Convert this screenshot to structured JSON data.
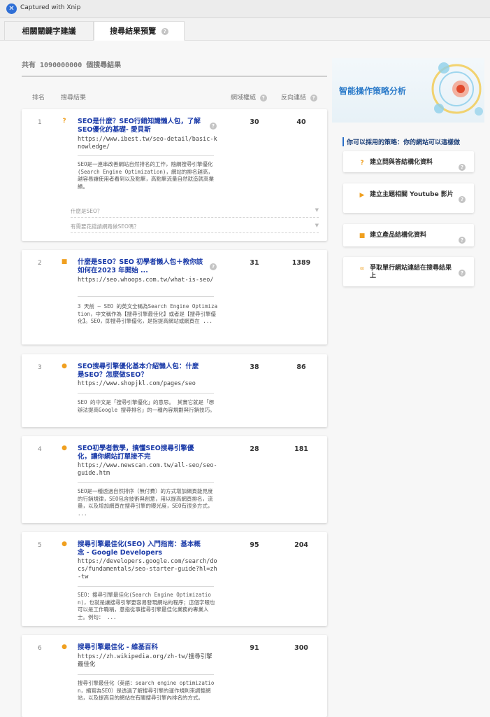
{
  "window": {
    "capture_label": "Captured with Xnip"
  },
  "tabs": [
    {
      "label": "相關關鍵字建議"
    },
    {
      "label": "搜尋結果預覽"
    }
  ],
  "summary": {
    "total_text": "共有 1090000000 個搜尋結果"
  },
  "columns": {
    "rank": "排名",
    "result": "搜尋結果",
    "authority": "網域權威",
    "backlinks": "反向連結"
  },
  "results": [
    {
      "rank": "1",
      "icon": "question-icon",
      "title": "SEO是什麼？SEO行銷知識懶人包，了解SEO優化的基礎- 愛貝斯",
      "url": "https://www.ibest.tw/seo-detail/basic-knowledge/",
      "desc": "SEO是一連串改善網站自然排名的工作，隨網搜尋引擎優化(Search Engine Optimization)，網站的排名越高，越容易讓使用者看到以及點擊，高點擊流量自然就造就高業績。",
      "authority": "30",
      "backlinks": "40",
      "faqs": [
        "什麼是SEO？",
        "有需要花錢請網路做SEO嗎？"
      ]
    },
    {
      "rank": "2",
      "icon": "box-icon",
      "title": "什麼是SEO？SEO 初學者懶人包＋教你該如何在2023 年開始 ...",
      "url": "https://seo.whoops.com.tw/what-is-seo/",
      "desc": "3 天前 — SEO 的英文全稱為Search Engine Optimization，中文稱作為【搜尋引擎最佳化】或者是【搜尋引擎優化】。SEO，即搜尋引擎優化，是指提高網站或網頁在 ...",
      "authority": "31",
      "backlinks": "1389"
    },
    {
      "rank": "3",
      "icon": "chat-icon",
      "title": "SEO搜尋引擎優化基本介紹懶人包：什麼是SEO？怎麼做SEO？",
      "url": "https://www.shopjkl.com/pages/seo",
      "desc": "SEO 的中文是「搜尋引擎優化」的意思。 其實它就是「想辦法提高Google 搜尋排名」的一種內容規劃與行銷技巧。",
      "authority": "38",
      "backlinks": "86"
    },
    {
      "rank": "4",
      "icon": "chat-icon",
      "title": "SEO初學者教學，搞懂SEO搜尋引擎優化，讓你網站訂單接不完",
      "url": "https://www.newscan.com.tw/all-seo/seo-guide.htm",
      "desc": "SEO是一種透過自然排序（無付費）的方式增加網頁能見度的行銷規律，SEO包含技術與創意，用以提高網頁排名，流量，以及增加網頁在搜尋引擎的曝光度，SEO有很多方式， ...",
      "authority": "28",
      "backlinks": "181"
    },
    {
      "rank": "5",
      "icon": "chat-icon",
      "title": "搜尋引擎最佳化(SEO) 入門指南：基本概念 - Google Developers",
      "url": "https://developers.google.com/search/docs/fundamentals/seo-starter-guide?hl=zh-tw",
      "desc": "SEO：搜尋引擎最佳化(Search Engine Optimization)，也就是讓搜尋引擎更容易發現網站的程序；這個字眼也可以是工作職稱，意指從事搜尋引擎最佳化業務的專業人士。例句： ...",
      "authority": "95",
      "backlinks": "204"
    },
    {
      "rank": "6",
      "icon": "chat-icon",
      "title": "搜尋引擎最佳化 - 維基百科",
      "url": "https://zh.wikipedia.org/zh-tw/搜尋引擎最佳化",
      "desc": "搜尋引擎最佳化（英語：search engine optimization，縮寫為SEO）是透過了解搜尋引擎的運作規則來調整網站，以及提高目的網站在有關搜尋引擎內排名的方式。",
      "authority": "91",
      "backlinks": "300"
    }
  ],
  "panel": {
    "title": "智能操作策略分析",
    "subtitle": "你可以採用的策略：你的網站可以這樣做",
    "strategies": [
      {
        "icon": "question-icon",
        "label": "建立問與答結構化資料"
      },
      {
        "icon": "video-icon",
        "label": "建立主題相關 Youtube 影片"
      },
      {
        "icon": "box-icon",
        "label": "建立產品結構化資料"
      },
      {
        "icon": "link-icon",
        "label": "爭取單行網站連結在搜尋結果上"
      }
    ]
  },
  "colors": {
    "accent": "#2a7ac9",
    "title_link": "#1a3aa8",
    "icon_orange": "#f0a020"
  }
}
